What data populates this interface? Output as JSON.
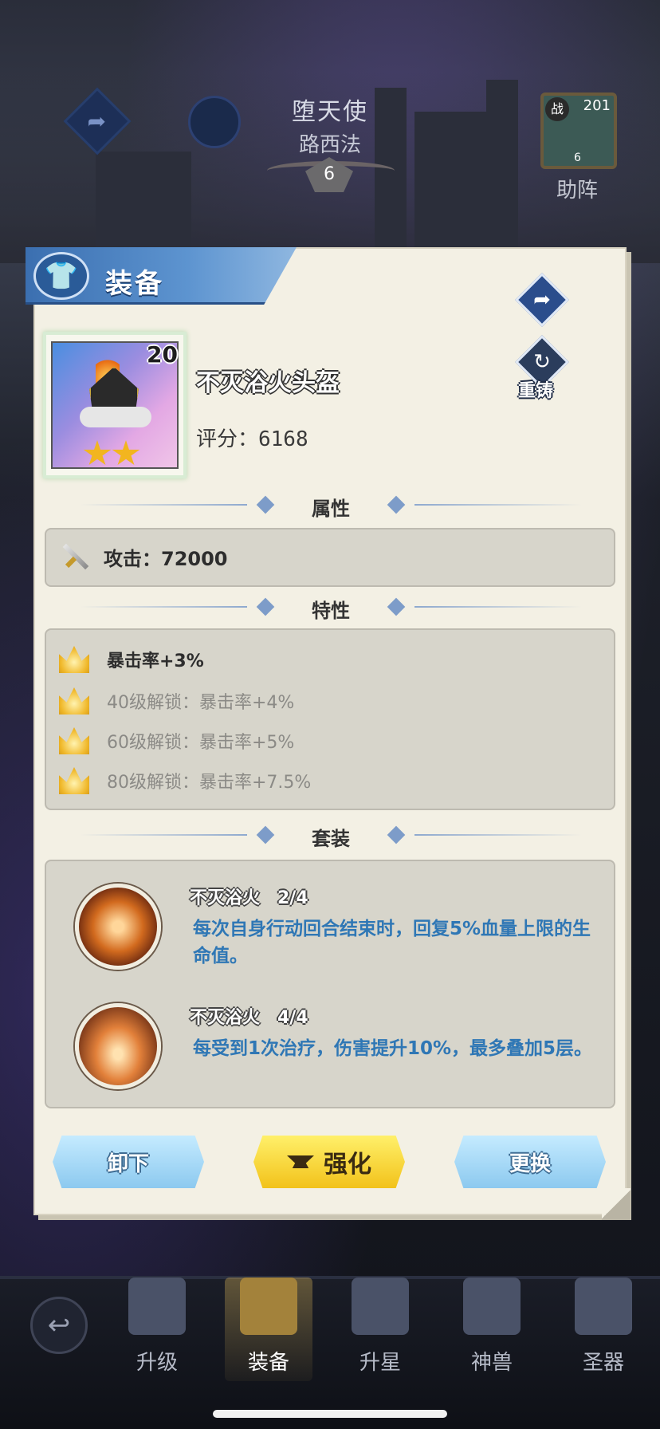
{
  "background": {
    "hero_title": "堕天使",
    "hero_subtitle": "路西法",
    "hero_rank": "6",
    "helper_level": "201",
    "helper_badge": "战",
    "helper_stars": "6",
    "helper_label": "助阵"
  },
  "panel": {
    "title": "装备",
    "reforge_label": "重铸",
    "item": {
      "name": "不灭浴火头盔",
      "level": "20",
      "stars": 2,
      "score_text": "评分：6168"
    },
    "sections": {
      "attributes": "属性",
      "traits": "特性",
      "set": "套装"
    },
    "attribute": "攻击：72000",
    "traits": [
      {
        "text": "暴击率+3%",
        "active": true
      },
      {
        "text": "40级解锁：暴击率+4%",
        "active": false
      },
      {
        "text": "60级解锁：暴击率+5%",
        "active": false
      },
      {
        "text": "80级解锁：暴击率+7.5%",
        "active": false
      }
    ],
    "set_bonuses": [
      {
        "title": "不灭浴火　2/4",
        "desc": "每次自身行动回合结束时，回复5%血量上限的生命值。"
      },
      {
        "title": "不灭浴火　4/4",
        "desc": "每受到1次治疗，伤害提升10%，最多叠加5层。"
      }
    ],
    "buttons": {
      "unequip": "卸下",
      "enhance": "强化",
      "replace": "更换"
    }
  },
  "bottom_nav": {
    "items": [
      {
        "label": "升级",
        "active": false
      },
      {
        "label": "装备",
        "active": true
      },
      {
        "label": "升星",
        "active": false
      },
      {
        "label": "神兽",
        "active": false
      },
      {
        "label": "圣器",
        "active": false
      }
    ]
  },
  "colors": {
    "panel_bg": "#f3f0e4",
    "header_blue": "#3b6fb0",
    "set_desc_blue": "#2f77b5",
    "enhance_yellow": "#f2c21a"
  }
}
